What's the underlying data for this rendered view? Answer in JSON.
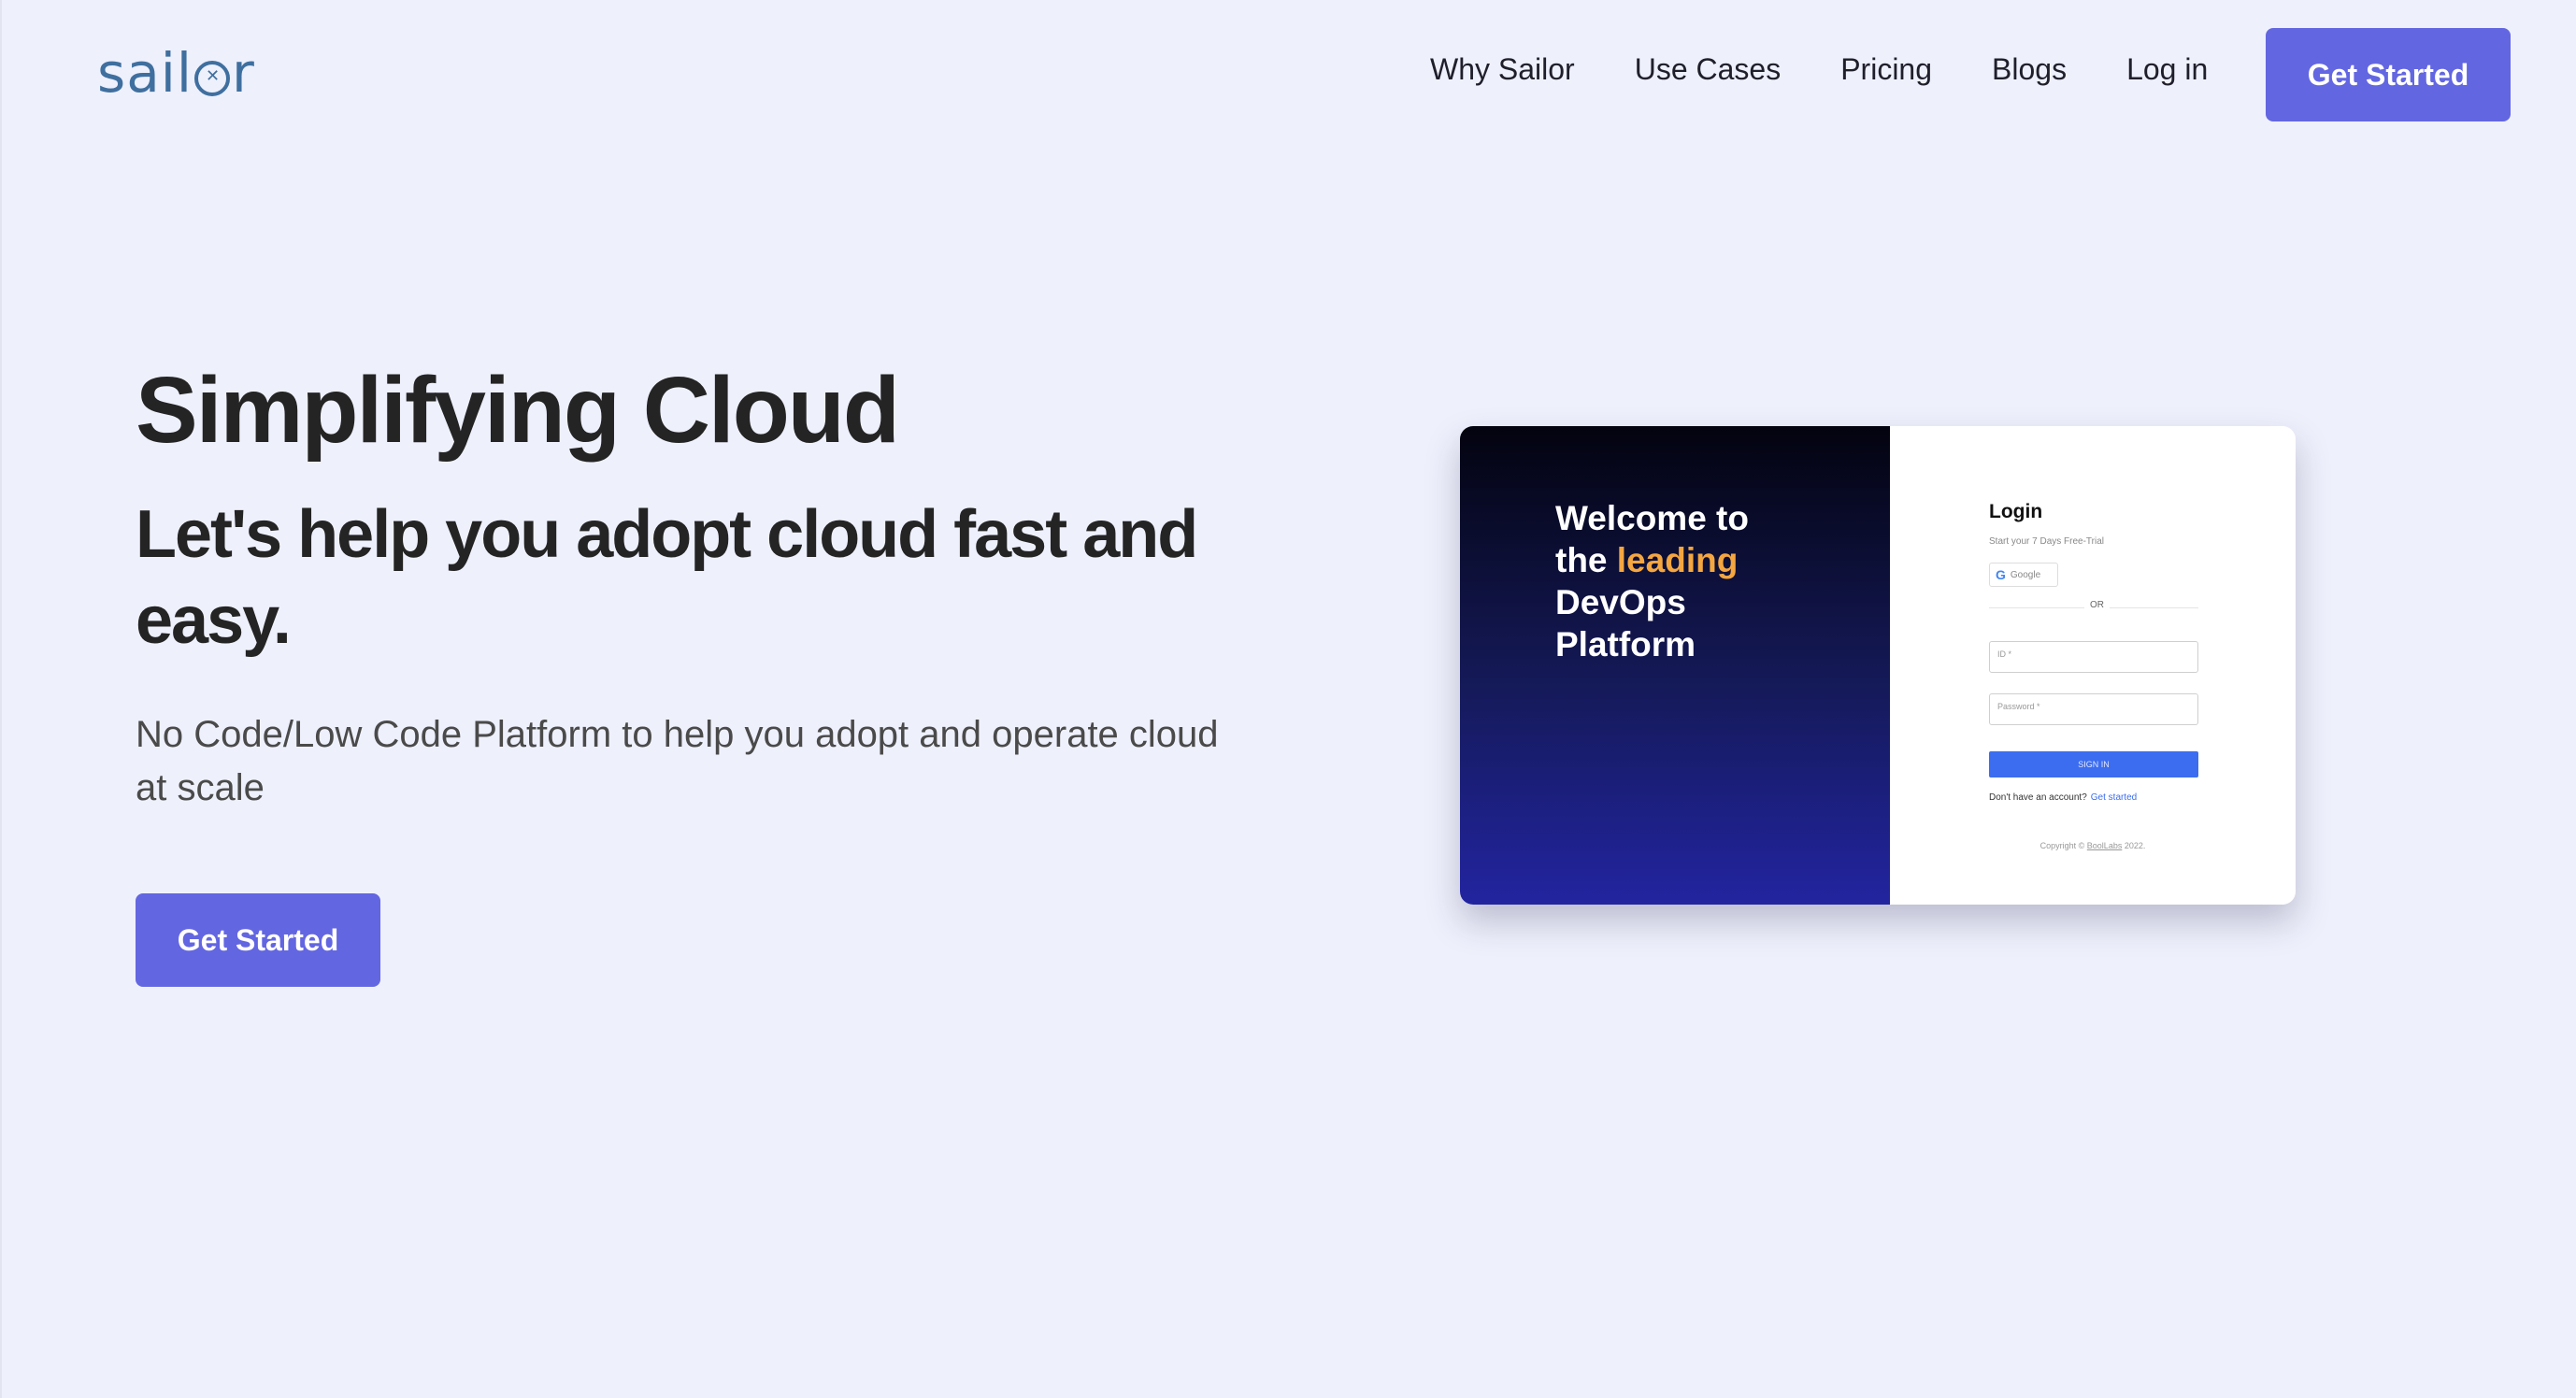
{
  "header": {
    "logo_text_before": "sail",
    "logo_text_after": "r",
    "nav": [
      "Why Sailor",
      "Use Cases",
      "Pricing",
      "Blogs",
      "Log in"
    ],
    "cta": "Get Started"
  },
  "hero": {
    "title": "Simplifying Cloud",
    "subtitle": "Let's help you adopt cloud fast and easy.",
    "description": "No Code/Low Code Platform to help you adopt and operate cloud at scale",
    "cta": "Get Started"
  },
  "preview": {
    "welcome_line1": "Welcome to",
    "welcome_the": "the",
    "welcome_accent": "leading",
    "welcome_line3": "DevOps",
    "welcome_line4": "Platform",
    "login_title": "Login",
    "login_subtitle": "Start your 7 Days Free-Trial",
    "google_label": "Google",
    "or_label": "OR",
    "id_placeholder": "ID *",
    "password_placeholder": "Password *",
    "signin_label": "SIGN IN",
    "no_account": "Don't have an account?",
    "get_started_link": "Get started",
    "copyright_prefix": "Copyright ©",
    "copyright_company": "BoolLabs",
    "copyright_year": "2022."
  },
  "colors": {
    "accent": "#6366e1",
    "background": "#eef0fc",
    "welcome_accent": "#f4a640",
    "signin": "#3c6df0"
  }
}
